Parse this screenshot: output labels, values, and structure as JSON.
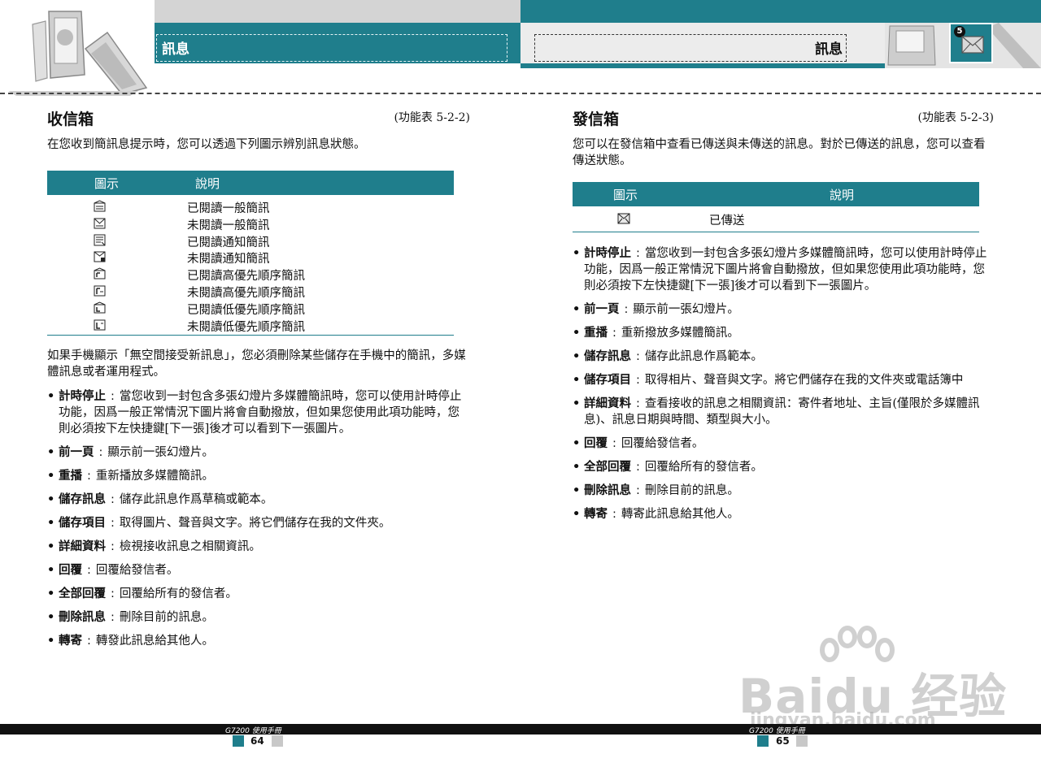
{
  "header": {
    "left_title": "訊息",
    "right_title": "訊息",
    "chapter_number": "5"
  },
  "left": {
    "title": "收信箱",
    "ref": "(功能表 5-2-2)",
    "intro": "在您收到簡訊息提示時，您可以透過下列圖示辨別訊息狀態。",
    "table_headers": [
      "圖示",
      "說明"
    ],
    "table_rows": [
      {
        "icon": "read-sms-icon",
        "text": "已閱讀一般簡訊"
      },
      {
        "icon": "unread-sms-icon",
        "text": "未閱讀一般簡訊"
      },
      {
        "icon": "read-notice-icon",
        "text": "已閱讀通知簡訊"
      },
      {
        "icon": "unread-notice-icon",
        "text": "未閱讀通知簡訊"
      },
      {
        "icon": "read-high-priority-icon",
        "text": "已閱讀高優先順序簡訊"
      },
      {
        "icon": "unread-high-priority-icon",
        "text": "未閱讀高優先順序簡訊"
      },
      {
        "icon": "read-low-priority-icon",
        "text": "已閱讀低優先順序簡訊"
      },
      {
        "icon": "unread-low-priority-icon",
        "text": "未閱讀低優先順序簡訊"
      }
    ],
    "paragraph": "如果手機顯示「無空間接受新訊息」，您必須刪除某些儲存在手機中的簡訊，多媒體訊息或者運用程式。",
    "items": [
      {
        "term": "計時停止",
        "desc": "當您收到一封包含多張幻燈片多媒體簡訊時，您可以使用計時停止功能，因爲一般正常情況下圖片將會自動撥放，但如果您使用此項功能時，您則必須按下左快捷鍵[下一張]後才可以看到下一張圖片。"
      },
      {
        "term": "前一頁",
        "desc": "顯示前一張幻燈片。"
      },
      {
        "term": "重播",
        "desc": "重新播放多媒體簡訊。"
      },
      {
        "term": "儲存訊息",
        "desc": "儲存此訊息作爲草稿或範本。"
      },
      {
        "term": "儲存項目",
        "desc": "取得圖片、聲音與文字。將它們儲存在我的文件夾。"
      },
      {
        "term": "詳細資料",
        "desc": "檢視接收訊息之相關資訊。"
      },
      {
        "term": "回覆",
        "desc": "回覆給發信者。"
      },
      {
        "term": "全部回覆",
        "desc": "回覆給所有的發信者。"
      },
      {
        "term": "刪除訊息",
        "desc": "刪除目前的訊息。"
      },
      {
        "term": "轉寄",
        "desc": "轉發此訊息給其他人。"
      }
    ]
  },
  "right": {
    "title": "發信箱",
    "ref": "(功能表 5-2-3)",
    "intro": "您可以在發信箱中查看已傳送與未傳送的訊息。對於已傳送的訊息，您可以查看傳送狀態。",
    "table_headers": [
      "圖示",
      "說明"
    ],
    "table_rows": [
      {
        "icon": "sent-icon",
        "text": "已傳送"
      }
    ],
    "items": [
      {
        "term": "計時停止",
        "desc": "當您收到一封包含多張幻燈片多媒體簡訊時，您可以使用計時停止功能，因爲一般正常情況下圖片將會自動撥放，但如果您使用此項功能時，您則必須按下左快捷鍵[下一張]後才可以看到下一張圖片。"
      },
      {
        "term": "前一頁",
        "desc": "顯示前一張幻燈片。"
      },
      {
        "term": "重播",
        "desc": "重新撥放多媒體簡訊。"
      },
      {
        "term": "儲存訊息",
        "desc": "儲存此訊息作爲範本。"
      },
      {
        "term": "儲存項目",
        "desc": "取得相片、聲音與文字。將它們儲存在我的文件夾或電話簿中"
      },
      {
        "term": "詳細資料",
        "desc": "查看接收的訊息之相關資訊：寄件者地址、主旨(僅限於多媒體訊息)、訊息日期與時間、類型與大小。"
      },
      {
        "term": "回覆",
        "desc": "回覆給發信者。"
      },
      {
        "term": "全部回覆",
        "desc": "回覆給所有的發信者。"
      },
      {
        "term": "刪除訊息",
        "desc": "刪除目前的訊息。"
      },
      {
        "term": "轉寄",
        "desc": "轉寄此訊息給其他人。"
      }
    ]
  },
  "footer": {
    "manual_label": "G7200 使用手冊",
    "left_page": "64",
    "right_page": "65"
  },
  "watermark": {
    "brand": "Baidu 经验",
    "url": "jingyan.baidu.com"
  },
  "colors": {
    "teal": "#1f7e8c",
    "gray": "#d4d4d4"
  }
}
